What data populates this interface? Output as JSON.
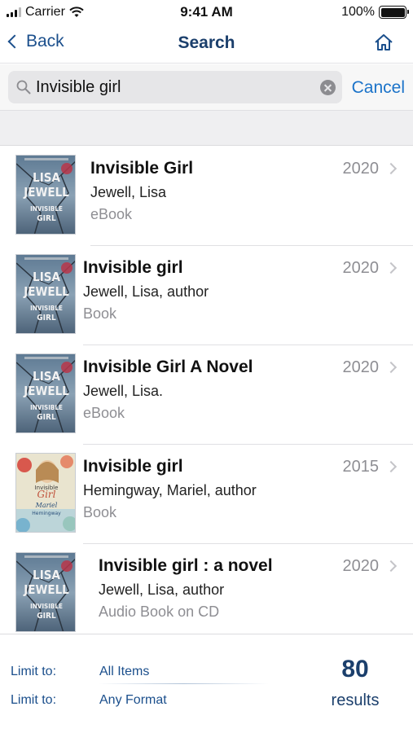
{
  "status_bar": {
    "carrier": "Carrier",
    "time": "9:41 AM",
    "battery": "100%",
    "battery_level": 1.0
  },
  "nav": {
    "back_label": "Back",
    "title": "Search",
    "home_icon": "home-icon"
  },
  "search": {
    "query": "Invisible girl",
    "cancel_label": "Cancel"
  },
  "results": [
    {
      "title": "Invisible Girl",
      "author": "Jewell, Lisa",
      "format": "eBook",
      "year": "2020",
      "cover_author": [
        "LISA",
        "JEWELL"
      ],
      "cover_title": [
        "INVISIBLE",
        "GIRL"
      ],
      "cover_style": "jewell"
    },
    {
      "title": "Invisible girl",
      "author": "Jewell, Lisa, author",
      "format": "Book",
      "year": "2020",
      "cover_author": [
        "LISA",
        "JEWELL"
      ],
      "cover_title": [
        "INVISIBLE",
        "GIRL"
      ],
      "cover_style": "jewell"
    },
    {
      "title": "Invisible Girl A Novel",
      "author": "Jewell, Lisa.",
      "format": "eBook",
      "year": "2020",
      "cover_author": [
        "LISA",
        "JEWELL"
      ],
      "cover_title": [
        "INVISIBLE",
        "GIRL"
      ],
      "cover_style": "jewell"
    },
    {
      "title": "Invisible girl",
      "author": "Hemingway, Mariel, author",
      "format": "Book",
      "year": "2015",
      "cover_author": [
        "Mariel",
        "Hemingway"
      ],
      "cover_title": [
        "Invisible",
        "Girl"
      ],
      "cover_style": "hemingway"
    },
    {
      "title": "Invisible girl : a novel",
      "author": "Jewell, Lisa, author",
      "format": "Audio Book on CD",
      "year": "2020",
      "cover_author": [
        "LISA",
        "JEWELL"
      ],
      "cover_title": [
        "INVISIBLE",
        "GIRL"
      ],
      "cover_style": "jewell"
    }
  ],
  "footer": {
    "limit1_label": "Limit to:",
    "limit1_value": "All Items",
    "limit2_label": "Limit to:",
    "limit2_value": "Any Format",
    "result_count": "80",
    "results_label": "results"
  },
  "colors": {
    "nav_blue": "#1b3f6c",
    "link_blue": "#1b73c9",
    "gray_text": "#8e8e93"
  }
}
